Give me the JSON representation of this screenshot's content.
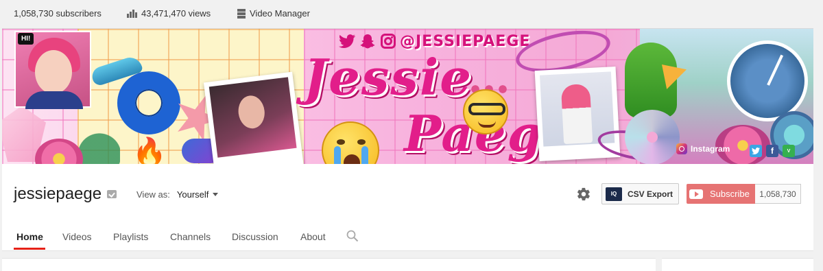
{
  "stats": {
    "subscribers": "1,058,730 subscribers",
    "views": "43,471,470 views",
    "video_manager": "Video Manager"
  },
  "banner": {
    "hi_bubble": "HI!",
    "handle": "@JESSIEPAEGE",
    "name_line1": "Jessie",
    "name_line2": "Paege",
    "instagram_label": "Instagram",
    "social_icons": [
      "twitter-icon",
      "facebook-icon",
      "vine-icon"
    ],
    "handle_icons": [
      "twitter-icon",
      "snapchat-icon",
      "instagram-icon"
    ],
    "colors": {
      "brand_pink": "#e21e8a",
      "grid_pink": "#f078be",
      "link_bar": "#28283c"
    }
  },
  "channel": {
    "name": "jessiepaege",
    "view_as_label": "View as:",
    "view_as_value": "Yourself",
    "csv_badge": "IQ",
    "csv_label": "CSV Export",
    "subscribe_label": "Subscribe",
    "subscriber_count": "1,058,730",
    "subscribe_color": "#e67373"
  },
  "tabs": [
    {
      "label": "Home",
      "active": true
    },
    {
      "label": "Videos",
      "active": false
    },
    {
      "label": "Playlists",
      "active": false
    },
    {
      "label": "Channels",
      "active": false
    },
    {
      "label": "Discussion",
      "active": false
    },
    {
      "label": "About",
      "active": false
    }
  ]
}
